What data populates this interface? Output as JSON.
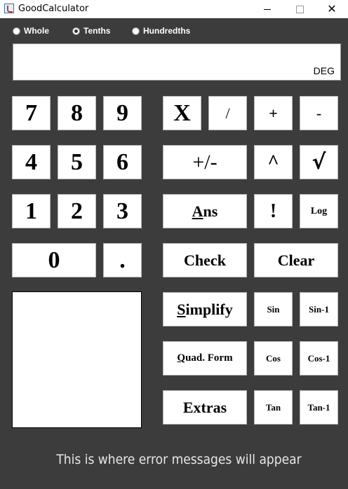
{
  "window": {
    "title": "GoodCalculator",
    "minimize_glyph": "",
    "close_glyph": "✕"
  },
  "radio_options": [
    {
      "label": "Whole",
      "selected": false
    },
    {
      "label": "Tenths",
      "selected": true
    },
    {
      "label": "Hundredths",
      "selected": false
    }
  ],
  "display": {
    "value": "",
    "mode": "DEG"
  },
  "digits": {
    "seven": "7",
    "eight": "8",
    "nine": "9",
    "four": "4",
    "five": "5",
    "six": "6",
    "one": "1",
    "two": "2",
    "three": "3",
    "zero": "0",
    "decimal": "."
  },
  "operators": {
    "multiply": "X",
    "divide": "/",
    "plus": "+",
    "minus": "-",
    "negate": "+/-",
    "power": "^",
    "sqrt": "√",
    "factorial": "!",
    "log": "Log"
  },
  "functions": {
    "ans_first": "A",
    "ans_rest": "ns",
    "check": "Check",
    "clear": "Clear",
    "simplify_first": "S",
    "simplify_rest": "implify",
    "quad_first": "Q",
    "quad_rest": "uad. Form",
    "extras": "Extras",
    "sin": "Sin",
    "asin": "Sin-1",
    "cos": "Cos",
    "acos": "Cos-1",
    "tan": "Tan",
    "atan": "Tan-1"
  },
  "status": {
    "message": "This is where error messages will appear"
  },
  "colors": {
    "background": "#3c3c3c",
    "button": "#ffffff",
    "text_light": "#ffffff"
  }
}
